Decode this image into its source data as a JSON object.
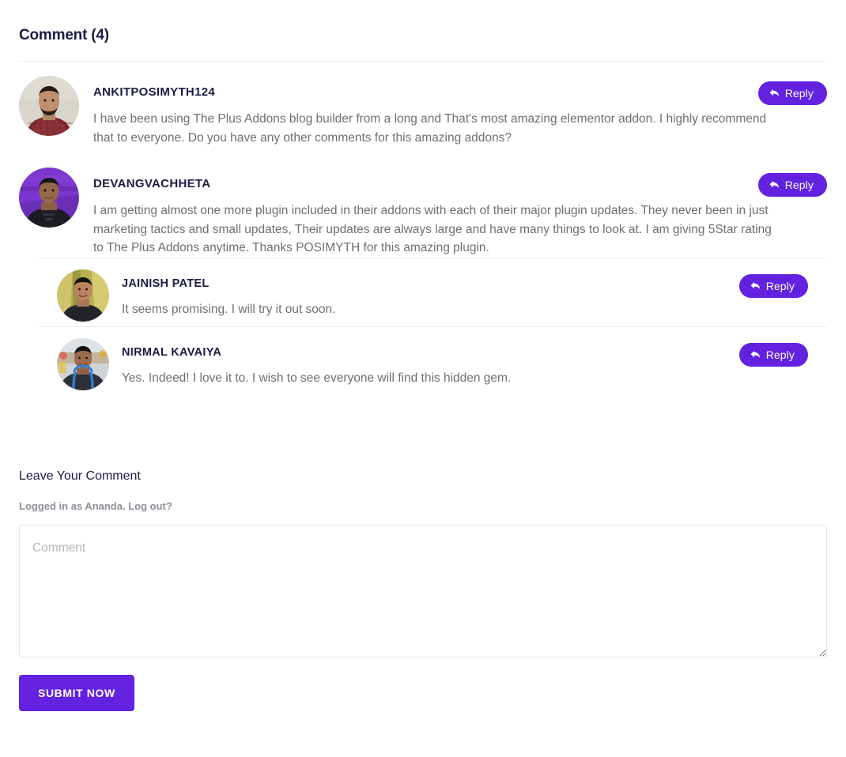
{
  "heading": {
    "label": "Comment (4)",
    "count": 4
  },
  "colors": {
    "accent_purple": "#6222e0",
    "heading_navy": "#1b1b46",
    "body_text": "#6d6f74",
    "muted_text": "#8b8f96",
    "divider": "#eceef1"
  },
  "reply_button": {
    "label": "Reply",
    "icon": "reply-arrow-icon"
  },
  "comments": [
    {
      "id": "c1",
      "author": "ANKITPOSIMYTH124",
      "avatar_name": "avatar-ankitposimyth124",
      "text": "I have been using The Plus Addons blog builder from a long and That's most amazing elementor addon. I highly recommend that to everyone. Do you have any other comments for this amazing addons?",
      "reply_label": "Reply"
    },
    {
      "id": "c2",
      "author": "DEVANGVACHHETA",
      "avatar_name": "avatar-devangvachheta",
      "text": "I am getting almost one more plugin included in their addons with each of their major plugin updates. They never been in just marketing tactics and small updates, Their updates are always large and have many things to look at. I am giving 5Star rating to The Plus Addons anytime. Thanks POSIMYTH for this amazing plugin.",
      "reply_label": "Reply",
      "children": [
        {
          "id": "c2r1",
          "author": "JAINISH PATEL",
          "avatar_name": "avatar-jainish-patel",
          "text": "It seems promising. I will try it out soon.",
          "reply_label": "Reply"
        },
        {
          "id": "c2r2",
          "author": "NIRMAL KAVAIYA",
          "avatar_name": "avatar-nirmal-kavaiya",
          "text": "Yes. Indeed! I love it to. I wish to see everyone will find this hidden gem.",
          "reply_label": "Reply"
        }
      ]
    }
  ],
  "respond": {
    "title": "Leave Your Comment",
    "logged_in_prefix": "Logged in as Ananda.",
    "logout_label": "Log out?",
    "textarea_placeholder": "Comment",
    "textarea_value": "",
    "submit_label": "SUBMIT NOW"
  }
}
